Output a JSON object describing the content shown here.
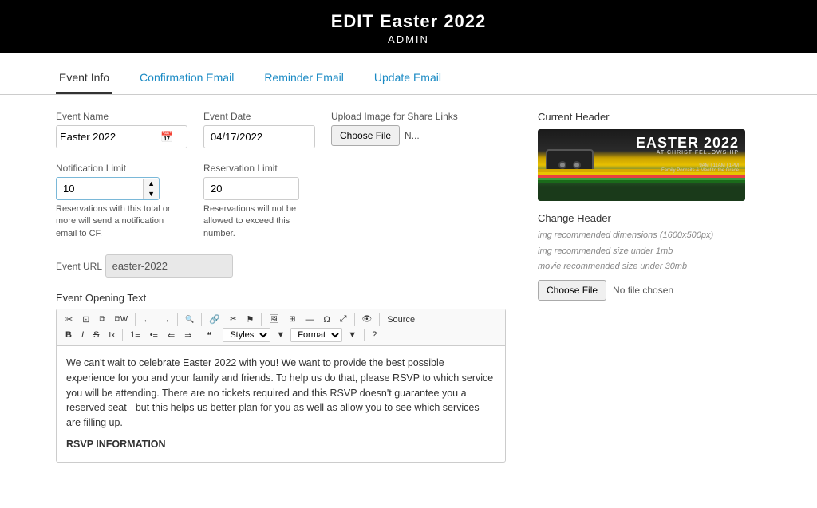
{
  "header": {
    "title": "EDIT Easter 2022",
    "subtitle": "ADMIN"
  },
  "tabs": [
    {
      "id": "event-info",
      "label": "Event Info",
      "active": true
    },
    {
      "id": "confirmation-email",
      "label": "Confirmation Email",
      "active": false
    },
    {
      "id": "reminder-email",
      "label": "Reminder Email",
      "active": false
    },
    {
      "id": "update-email",
      "label": "Update Email",
      "active": false
    }
  ],
  "form": {
    "event_name_label": "Event Name",
    "event_name_value": "Easter 2022",
    "event_date_label": "Event Date",
    "event_date_value": "04/17/2022",
    "upload_label": "Upload Image for Share Links",
    "choose_file_label": "Choose File",
    "file_name": "N...",
    "notification_limit_label": "Notification Limit",
    "notification_limit_value": "10",
    "notification_hint": "Reservations with this total or more will send a notification email to CF.",
    "reservation_limit_label": "Reservation Limit",
    "reservation_limit_value": "20",
    "reservation_hint": "Reservations will not be allowed to exceed this number.",
    "event_url_label": "Event URL",
    "event_url_value": "easter-2022",
    "event_opening_text_label": "Event Opening Text"
  },
  "editor": {
    "toolbar": {
      "cut": "✂",
      "copy": "⊡",
      "paste_text": "📋",
      "paste_word": "📄",
      "undo": "←",
      "redo": "→",
      "find": "🔍",
      "link": "🔗",
      "unlink": "✂",
      "anchor": "⚑",
      "image": "🖼",
      "table": "⊞",
      "horizontal_rule": "—",
      "special_char": "Ω",
      "maximize": "⤢",
      "preview": "👁",
      "source": "Source",
      "bold": "B",
      "italic": "I",
      "strike": "S",
      "subscript": "Ix",
      "ol": "#",
      "ul": "•",
      "outdent": "⇐",
      "indent": "⇒",
      "blockquote": "❝",
      "styles_label": "Styles",
      "format_label": "Format",
      "help": "?"
    },
    "body_text": "We can't wait to celebrate Easter 2022 with you! We want to provide the best possible experience for you and your family and friends. To help us do that, please RSVP to which service you will be attending. There are no tickets required and this RSVP doesn't guarantee you a reserved seat - but this helps us better plan for you as well as allow you to see which services are filling up.",
    "rsvp_heading": "RSVP INFORMATION"
  },
  "right_panel": {
    "current_header_label": "Current Header",
    "change_header_label": "Change Header",
    "hint_dimensions": "img recommended dimensions (1600x500px)",
    "hint_size": "img recommended size under 1mb",
    "hint_movie": "movie recommended size under 30mb",
    "choose_file_label": "Choose File",
    "no_file_text": "No file chosen"
  },
  "colors": {
    "accent_blue": "#1a8ac4",
    "header_black": "#000000",
    "tab_border": "#cccccc"
  }
}
